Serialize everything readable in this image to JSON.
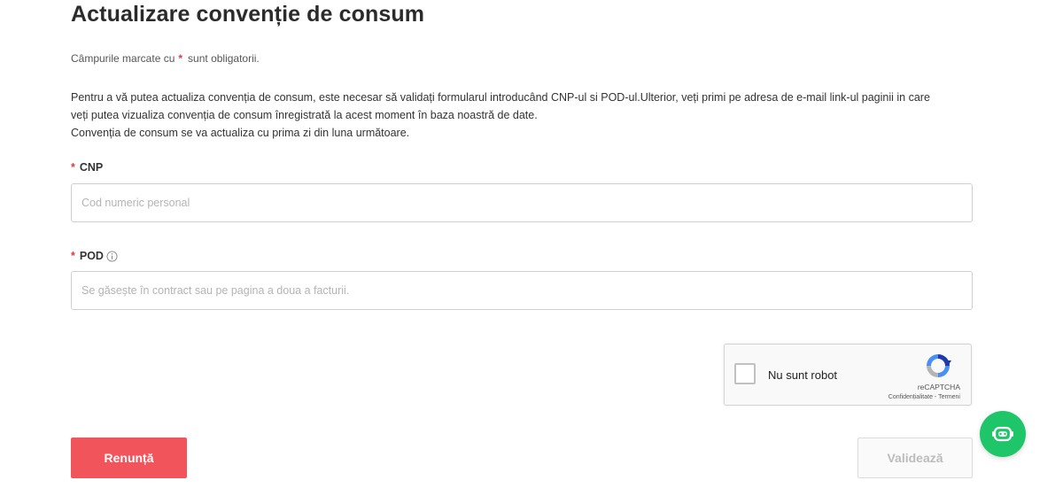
{
  "page": {
    "title": "Actualizare convenție de consum",
    "required_note": {
      "before": "Câmpurile marcate cu",
      "star": "*",
      "after": "sunt obligatorii."
    },
    "intro_lines": [
      "Pentru a vă putea actualiza convenția de consum, este necesar să validați formularul introducând CNP-ul si POD-ul.Ulterior, veți primi pe adresa de e-mail link-ul paginii in care",
      "veți putea vizualiza convenția de consum înregistrată la acest moment în baza noastră de date.",
      "Convenția de consum se va actualiza cu prima zi din luna următoare."
    ]
  },
  "form": {
    "cnp": {
      "star": "*",
      "label": "CNP",
      "value": "",
      "placeholder": "Cod numeric personal"
    },
    "pod": {
      "star": "*",
      "label": "POD",
      "value": "",
      "placeholder": "Se găsește în contract sau pe pagina a doua a facturii."
    }
  },
  "recaptcha": {
    "label": "Nu sunt robot",
    "brand": "reCAPTCHA",
    "privacy": "Confidențialitate",
    "separator": " - ",
    "terms": "Termeni",
    "checked": false
  },
  "buttons": {
    "cancel": "Renunță",
    "validate": "Validează"
  },
  "icons": {
    "info": "info-circle-icon",
    "recaptcha": "recaptcha-logo-icon",
    "chat": "chatbot-icon"
  },
  "colors": {
    "accent_red": "#f2545b",
    "required_star": "#e03a3e",
    "chat_green": "#1fc569",
    "disabled_text": "#bcbcbc"
  }
}
